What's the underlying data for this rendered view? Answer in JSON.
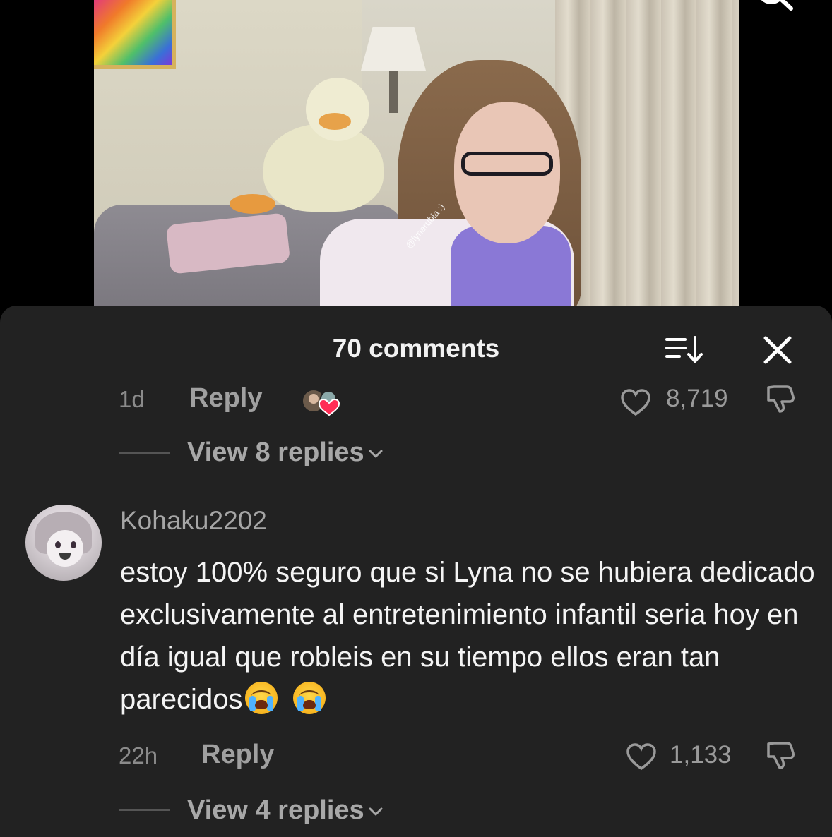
{
  "video": {
    "watermark": "@lynarubia :)"
  },
  "comments_panel": {
    "title": "70 comments",
    "previous_comment": {
      "time": "1d",
      "reply_label": "Reply",
      "likes": "8,719",
      "view_replies": "View 8 replies"
    },
    "comment": {
      "username": "Kohaku2202",
      "text": "estoy 100% seguro que si Lyna no se hubiera dedicado exclusivamente al entretenimiento infantil seria hoy en día igual que robleis en su tiempo ellos eran tan parecidos",
      "emojis": [
        "😭",
        "😭"
      ],
      "time": "22h",
      "reply_label": "Reply",
      "likes": "1,133",
      "view_replies": "View 4 replies"
    }
  },
  "icons": {
    "search": "search-icon",
    "sort": "sort-icon",
    "close": "close-icon",
    "like": "heart-outline-icon",
    "dislike": "thumbs-down-icon",
    "chevron": "chevron-down-icon"
  },
  "colors": {
    "sheet_background": "#222222",
    "heart_badge": "#ff2d55"
  }
}
